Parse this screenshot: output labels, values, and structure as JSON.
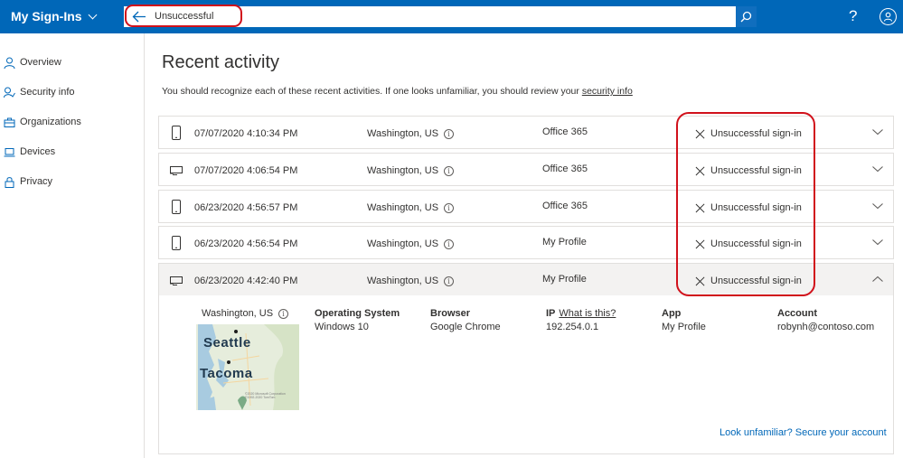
{
  "app": {
    "title": "My Sign-Ins"
  },
  "search": {
    "value": "Unsuccessful"
  },
  "sidebar": {
    "items": [
      {
        "label": "Overview",
        "icon": "person-icon"
      },
      {
        "label": "Security info",
        "icon": "security-info-icon"
      },
      {
        "label": "Organizations",
        "icon": "briefcase-icon"
      },
      {
        "label": "Devices",
        "icon": "laptop-icon"
      },
      {
        "label": "Privacy",
        "icon": "lock-icon"
      }
    ]
  },
  "main": {
    "title": "Recent activity",
    "subtitle": "You should recognize each of these recent activities. If one looks unfamiliar, you should review your",
    "subtitle_link": "security info"
  },
  "activities": [
    {
      "device": "phone-icon",
      "date": "07/07/2020 4:10:34 PM",
      "location": "Washington, US",
      "app": "Office 365",
      "status": "Unsuccessful sign-in",
      "expanded": false
    },
    {
      "device": "computer-icon",
      "date": "07/07/2020 4:06:54 PM",
      "location": "Washington, US",
      "app": "Office 365",
      "status": "Unsuccessful sign-in",
      "expanded": false
    },
    {
      "device": "phone-icon",
      "date": "06/23/2020 4:56:57 PM",
      "location": "Washington, US",
      "app": "Office 365",
      "status": "Unsuccessful sign-in",
      "expanded": false
    },
    {
      "device": "phone-icon",
      "date": "06/23/2020 4:56:54 PM",
      "location": "Washington, US",
      "app": "My Profile",
      "status": "Unsuccessful sign-in",
      "expanded": false
    },
    {
      "device": "computer-icon",
      "date": "06/23/2020 4:42:40 PM",
      "location": "Washington, US",
      "app": "My Profile",
      "status": "Unsuccessful sign-in",
      "expanded": true
    }
  ],
  "details": {
    "location": "Washington, US",
    "map": {
      "city1": "Seattle",
      "city2": "Tacoma",
      "credit1": "©2020 Microsoft Corporation",
      "credit2": "©1992-2020 TomTom"
    },
    "os_label": "Operating System",
    "os_value": "Windows 10",
    "browser_label": "Browser",
    "browser_value": "Google Chrome",
    "ip_label": "IP",
    "ip_link": "What is this?",
    "ip_value": "192.254.0.1",
    "app_label": "App",
    "app_value": "My Profile",
    "account_label": "Account",
    "account_value": "robynh@contoso.com",
    "secure_link": "Look unfamiliar? Secure your account"
  },
  "colors": {
    "brand": "#0067b8",
    "highlight": "#d1111b"
  }
}
